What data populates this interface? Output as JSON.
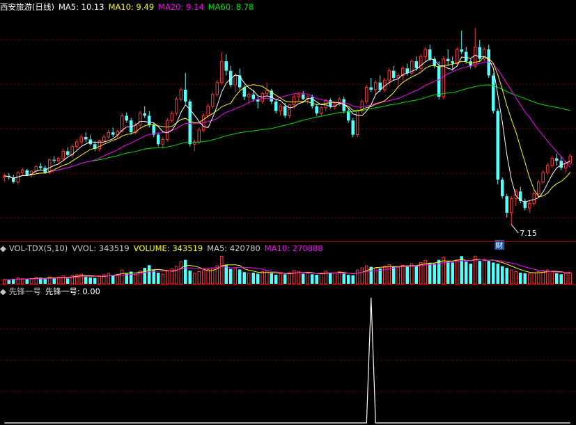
{
  "colors": {
    "up": "#ff3232",
    "down": "#54ffff",
    "ma5": "#ffffff",
    "ma10": "#ffff00",
    "ma20": "#ff00ff",
    "ma60": "#00e000",
    "grid": "#7a0000",
    "panel_border": "#b00000",
    "text": "#c8c8c8",
    "ann_bg": "#1e5aa8"
  },
  "price_panel": {
    "title": "西安旅游(日线)",
    "legend": [
      {
        "name": "MA5",
        "value": "10.13",
        "color_key": "ma5"
      },
      {
        "name": "MA10",
        "value": "9.49",
        "color_key": "ma10"
      },
      {
        "name": "MA20",
        "value": "9.14",
        "color_key": "ma20"
      },
      {
        "name": "MA60",
        "value": "8.78",
        "color_key": "ma60"
      }
    ],
    "low_label": "7.15",
    "badge": "财"
  },
  "volume_panel": {
    "indicator": "VOL-TDX(5,10)",
    "legend": [
      {
        "name": "VVOL",
        "value": "343519",
        "color_key": "text"
      },
      {
        "name": "VOLUME",
        "value": "343519",
        "color_key": "ma10"
      },
      {
        "name": "MA5",
        "value": "420780",
        "color_key": "text"
      },
      {
        "name": "MA10",
        "value": "270888",
        "color_key": "ma20"
      }
    ]
  },
  "signal_panel": {
    "title": "先锋一号",
    "series_name": "先锋一号",
    "value": "0.00"
  },
  "chart_data": [
    {
      "type": "candlestick",
      "title": "西安旅游(日线)",
      "note": "Approximate OHLC values estimated visually from the chart (no price axis shown).",
      "ylim": [
        6.9,
        11.6
      ],
      "ohlc": [
        [
          8.15,
          8.22,
          8.05,
          8.18
        ],
        [
          8.18,
          8.24,
          8.1,
          8.15
        ],
        [
          8.15,
          8.2,
          8.02,
          8.05
        ],
        [
          8.05,
          8.28,
          8.0,
          8.25
        ],
        [
          8.25,
          8.35,
          8.2,
          8.3
        ],
        [
          8.3,
          8.33,
          8.18,
          8.2
        ],
        [
          8.2,
          8.3,
          8.15,
          8.28
        ],
        [
          8.28,
          8.4,
          8.25,
          8.38
        ],
        [
          8.38,
          8.45,
          8.3,
          8.35
        ],
        [
          8.35,
          8.4,
          8.22,
          8.25
        ],
        [
          8.25,
          8.55,
          8.22,
          8.52
        ],
        [
          8.52,
          8.6,
          8.45,
          8.5
        ],
        [
          8.5,
          8.58,
          8.42,
          8.55
        ],
        [
          8.55,
          8.75,
          8.5,
          8.7
        ],
        [
          8.7,
          8.78,
          8.6,
          8.62
        ],
        [
          8.62,
          8.85,
          8.55,
          8.8
        ],
        [
          8.8,
          8.95,
          8.72,
          8.9
        ],
        [
          8.9,
          9.05,
          8.85,
          9.0
        ],
        [
          9.0,
          9.1,
          8.9,
          8.95
        ],
        [
          8.95,
          9.05,
          8.82,
          8.85
        ],
        [
          8.85,
          8.92,
          8.7,
          8.75
        ],
        [
          8.75,
          8.95,
          8.7,
          8.92
        ],
        [
          8.92,
          9.05,
          8.88,
          9.0
        ],
        [
          9.0,
          9.15,
          8.95,
          9.1
        ],
        [
          9.1,
          9.2,
          9.0,
          9.05
        ],
        [
          9.05,
          9.15,
          8.98,
          9.12
        ],
        [
          9.12,
          9.5,
          9.1,
          9.45
        ],
        [
          9.45,
          9.52,
          9.3,
          9.35
        ],
        [
          9.35,
          9.4,
          9.05,
          9.1
        ],
        [
          9.1,
          9.3,
          9.05,
          9.25
        ],
        [
          9.25,
          9.55,
          9.2,
          9.5
        ],
        [
          9.5,
          9.65,
          9.4,
          9.45
        ],
        [
          9.45,
          9.55,
          9.2,
          9.25
        ],
        [
          9.25,
          9.3,
          9.0,
          9.05
        ],
        [
          9.05,
          9.1,
          8.8,
          8.85
        ],
        [
          8.85,
          9.0,
          8.75,
          8.95
        ],
        [
          8.95,
          9.4,
          8.9,
          9.35
        ],
        [
          9.35,
          9.55,
          9.3,
          9.5
        ],
        [
          9.5,
          9.85,
          9.45,
          9.8
        ],
        [
          9.8,
          10.05,
          9.75,
          10.0
        ],
        [
          10.0,
          10.35,
          9.7,
          9.75
        ],
        [
          9.75,
          9.8,
          8.8,
          8.85
        ],
        [
          8.85,
          8.95,
          8.7,
          8.9
        ],
        [
          8.9,
          9.2,
          8.85,
          9.15
        ],
        [
          9.15,
          9.5,
          9.1,
          9.45
        ],
        [
          9.45,
          9.7,
          9.4,
          9.65
        ],
        [
          9.65,
          9.95,
          9.6,
          9.9
        ],
        [
          9.9,
          10.2,
          9.85,
          10.15
        ],
        [
          10.15,
          10.8,
          10.1,
          10.6
        ],
        [
          10.6,
          10.75,
          10.3,
          10.4
        ],
        [
          10.4,
          10.5,
          10.05,
          10.1
        ],
        [
          10.1,
          10.35,
          9.95,
          10.3
        ],
        [
          10.3,
          10.45,
          10.0,
          10.05
        ],
        [
          10.05,
          10.1,
          9.78,
          9.85
        ],
        [
          9.85,
          9.95,
          9.7,
          9.9
        ],
        [
          9.9,
          10.0,
          9.75,
          9.8
        ],
        [
          9.8,
          9.85,
          9.6,
          9.75
        ],
        [
          9.75,
          9.95,
          9.7,
          9.92
        ],
        [
          9.92,
          10.15,
          9.85,
          9.98
        ],
        [
          9.98,
          10.02,
          9.7,
          9.75
        ],
        [
          9.75,
          9.8,
          9.5,
          9.55
        ],
        [
          9.55,
          9.7,
          9.45,
          9.65
        ],
        [
          9.65,
          9.72,
          9.4,
          9.45
        ],
        [
          9.45,
          9.7,
          9.4,
          9.68
        ],
        [
          9.68,
          9.9,
          9.6,
          9.85
        ],
        [
          9.85,
          9.95,
          9.75,
          9.9
        ],
        [
          9.9,
          9.97,
          9.78,
          9.8
        ],
        [
          9.8,
          9.88,
          9.7,
          9.85
        ],
        [
          9.85,
          9.9,
          9.6,
          9.65
        ],
        [
          9.65,
          9.7,
          9.45,
          9.5
        ],
        [
          9.5,
          9.65,
          9.45,
          9.62
        ],
        [
          9.62,
          9.8,
          9.55,
          9.78
        ],
        [
          9.78,
          9.82,
          9.6,
          9.65
        ],
        [
          9.65,
          9.75,
          9.58,
          9.7
        ],
        [
          9.7,
          9.85,
          9.65,
          9.8
        ],
        [
          9.8,
          9.85,
          9.5,
          9.55
        ],
        [
          9.55,
          9.6,
          9.3,
          9.35
        ],
        [
          9.35,
          9.4,
          9.0,
          9.05
        ],
        [
          9.05,
          9.6,
          9.0,
          9.55
        ],
        [
          9.55,
          9.8,
          9.5,
          9.75
        ],
        [
          9.75,
          10.1,
          9.7,
          10.05
        ],
        [
          10.05,
          10.25,
          9.95,
          10.0
        ],
        [
          10.0,
          10.2,
          9.9,
          10.15
        ],
        [
          10.15,
          10.3,
          9.95,
          10.0
        ],
        [
          10.0,
          10.25,
          9.95,
          10.2
        ],
        [
          10.2,
          10.45,
          10.1,
          10.4
        ],
        [
          10.4,
          10.5,
          10.2,
          10.25
        ],
        [
          10.25,
          10.35,
          10.1,
          10.3
        ],
        [
          10.3,
          10.5,
          10.2,
          10.45
        ],
        [
          10.45,
          10.55,
          10.3,
          10.35
        ],
        [
          10.35,
          10.65,
          10.3,
          10.6
        ],
        [
          10.6,
          10.7,
          10.4,
          10.45
        ],
        [
          10.45,
          10.75,
          10.4,
          10.7
        ],
        [
          10.7,
          10.9,
          10.6,
          10.85
        ],
        [
          10.85,
          10.95,
          10.6,
          10.65
        ],
        [
          10.65,
          10.7,
          10.45,
          10.5
        ],
        [
          10.5,
          10.6,
          9.8,
          9.85
        ],
        [
          9.85,
          10.7,
          9.8,
          10.65
        ],
        [
          10.65,
          10.85,
          10.5,
          10.6
        ],
        [
          10.6,
          10.7,
          10.4,
          10.55
        ],
        [
          10.55,
          10.9,
          10.5,
          10.85
        ],
        [
          10.85,
          11.25,
          10.75,
          10.8
        ],
        [
          10.8,
          10.9,
          10.55,
          10.6
        ],
        [
          10.6,
          10.65,
          10.45,
          10.5
        ],
        [
          10.5,
          11.3,
          10.45,
          10.9
        ],
        [
          10.9,
          11.05,
          10.6,
          10.65
        ],
        [
          10.65,
          10.9,
          10.6,
          10.85
        ],
        [
          10.85,
          10.95,
          10.25,
          10.3
        ],
        [
          10.3,
          10.35,
          9.5,
          9.55
        ],
        [
          9.55,
          9.6,
          8.0,
          8.1
        ],
        [
          8.1,
          8.15,
          7.7,
          7.75
        ],
        [
          7.75,
          7.8,
          7.3,
          7.4
        ],
        [
          7.4,
          7.75,
          7.15,
          7.7
        ],
        [
          7.7,
          7.9,
          7.55,
          7.85
        ],
        [
          7.85,
          7.95,
          7.6,
          7.65
        ],
        [
          7.65,
          7.7,
          7.45,
          7.5
        ],
        [
          7.5,
          7.65,
          7.4,
          7.6
        ],
        [
          7.6,
          7.85,
          7.55,
          7.8
        ],
        [
          7.8,
          8.1,
          7.75,
          8.05
        ],
        [
          8.05,
          8.3,
          8.0,
          8.25
        ],
        [
          8.25,
          8.45,
          8.2,
          8.4
        ],
        [
          8.4,
          8.6,
          8.35,
          8.55
        ],
        [
          8.55,
          8.65,
          8.4,
          8.5
        ],
        [
          8.5,
          8.6,
          8.3,
          8.35
        ],
        [
          8.35,
          8.5,
          8.25,
          8.45
        ],
        [
          8.45,
          8.65,
          8.4,
          8.6
        ]
      ]
    },
    {
      "type": "bar",
      "title": "VOL-TDX(5,10)",
      "note": "Approximate volume per bar in units of 1000, estimated visually.",
      "values": [
        80,
        70,
        90,
        110,
        95,
        85,
        100,
        120,
        115,
        90,
        130,
        110,
        125,
        150,
        100,
        160,
        170,
        180,
        140,
        120,
        110,
        150,
        170,
        200,
        160,
        180,
        260,
        190,
        230,
        175,
        240,
        300,
        350,
        260,
        210,
        180,
        250,
        280,
        330,
        420,
        450,
        250,
        200,
        230,
        260,
        270,
        300,
        340,
        520,
        350,
        280,
        300,
        270,
        220,
        200,
        210,
        190,
        230,
        240,
        200,
        170,
        190,
        180,
        210,
        250,
        230,
        190,
        200,
        180,
        170,
        200,
        240,
        210,
        200,
        230,
        190,
        170,
        160,
        260,
        300,
        340,
        320,
        300,
        290,
        330,
        360,
        330,
        310,
        350,
        330,
        380,
        340,
        400,
        440,
        390,
        380,
        450,
        500,
        420,
        400,
        450,
        520,
        420,
        380,
        520,
        430,
        460,
        430,
        400,
        380,
        330,
        300,
        260,
        230,
        210,
        200,
        190,
        210,
        230,
        250,
        260,
        230,
        200,
        180,
        190,
        210
      ]
    },
    {
      "type": "line",
      "title": "先锋一号",
      "series": [
        {
          "name": "先锋一号"
        }
      ],
      "note": "Signal indicator: zero everywhere except a single spike at one bar.",
      "values": [
        0,
        0,
        0,
        0,
        0,
        0,
        0,
        0,
        0,
        0,
        0,
        0,
        0,
        0,
        0,
        0,
        0,
        0,
        0,
        0,
        0,
        0,
        0,
        0,
        0,
        0,
        0,
        0,
        0,
        0,
        0,
        0,
        0,
        0,
        0,
        0,
        0,
        0,
        0,
        0,
        0,
        0,
        0,
        0,
        0,
        0,
        0,
        0,
        0,
        0,
        0,
        0,
        0,
        0,
        0,
        0,
        0,
        0,
        0,
        0,
        0,
        0,
        0,
        0,
        0,
        0,
        0,
        0,
        0,
        0,
        0,
        0,
        0,
        0,
        0,
        0,
        0,
        0,
        0,
        0,
        0,
        1,
        0,
        0,
        0,
        0,
        0,
        0,
        0,
        0,
        0,
        0,
        0,
        0,
        0,
        0,
        0,
        0,
        0,
        0,
        0,
        0,
        0,
        0,
        0,
        0,
        0,
        0,
        0,
        0,
        0,
        0,
        0,
        0,
        0,
        0,
        0,
        0,
        0,
        0,
        0,
        0,
        0,
        0,
        0,
        0
      ]
    }
  ]
}
